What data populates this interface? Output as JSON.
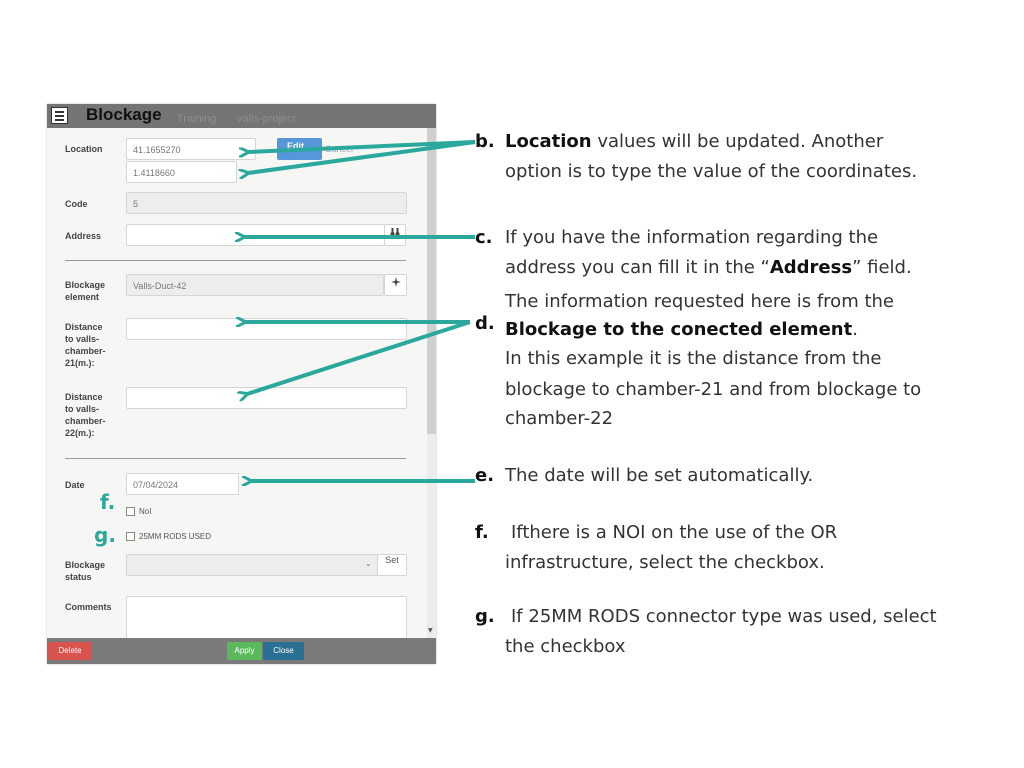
{
  "panel": {
    "title": "Blockage",
    "ghost_tabs": [
      "Training",
      "valls-project"
    ],
    "location": {
      "label": "Location",
      "lat": "41.1655270",
      "lng": "1.4118660",
      "edit_button": "Edit",
      "second_button": "Cancel"
    },
    "code": {
      "label": "Code",
      "value": "5"
    },
    "address": {
      "label": "Address",
      "value": "",
      "search_icon": "binoculars-icon"
    },
    "blockage_element": {
      "label_line1": "Blockage",
      "label_line2": "element",
      "value": "Valls-Duct-42",
      "button_icon": "crosshair-icon"
    },
    "distance1": {
      "label_lines": [
        "Distance",
        "to valls-",
        "chamber-",
        "21(m.):"
      ],
      "value": ""
    },
    "distance2": {
      "label_lines": [
        "Distance",
        "to valls-",
        "chamber-",
        "22(m.):"
      ],
      "value": ""
    },
    "date": {
      "label": "Date",
      "value": "07/04/2024"
    },
    "checkbox_noi": {
      "label": "NoI",
      "checked": false,
      "marker": "f."
    },
    "checkbox_rods": {
      "label": "25MM RODS USED",
      "checked": false,
      "marker": "g."
    },
    "status": {
      "label_line1": "Blockage",
      "label_line2": "status",
      "value": "",
      "set_button": "Set"
    },
    "comments": {
      "label": "Comments",
      "value": ""
    },
    "footer": {
      "delete": "Delete",
      "apply": "Apply",
      "close": "Close"
    }
  },
  "annotations": {
    "b": {
      "letter": "b.",
      "bold": "Location",
      "rest1": " values will be updated. Another",
      "line2": "option is to type the value of the coordinates."
    },
    "c": {
      "letter": "c.",
      "line1": "If you have the information regarding the",
      "line2_pre": "address you can fill it in the “",
      "line2_bold": "Address",
      "line2_post": "” field."
    },
    "d": {
      "letter": "d.",
      "line1": "The information requested here is from the",
      "line2_bold": "Blockage to the conected element",
      "line2_post": ".",
      "line3": "In this example it is the distance from the",
      "line4": "blockage to chamber-21 and from blockage to",
      "line5": "chamber-22"
    },
    "e": {
      "letter": "e.",
      "line1": "The date will be set automatically."
    },
    "f": {
      "letter": "f.",
      "line1": "Ifthere is a NOI on the use of the OR",
      "line2": "infrastructure, select the checkbox."
    },
    "g": {
      "letter": "g.",
      "line1": "If 25MM RODS connector type was used, select",
      "line2": "the checkbox"
    }
  },
  "colors": {
    "arrow": "#2aa89c",
    "delete": "#d9534f",
    "apply": "#5cb85c",
    "close": "#2a6f94"
  }
}
